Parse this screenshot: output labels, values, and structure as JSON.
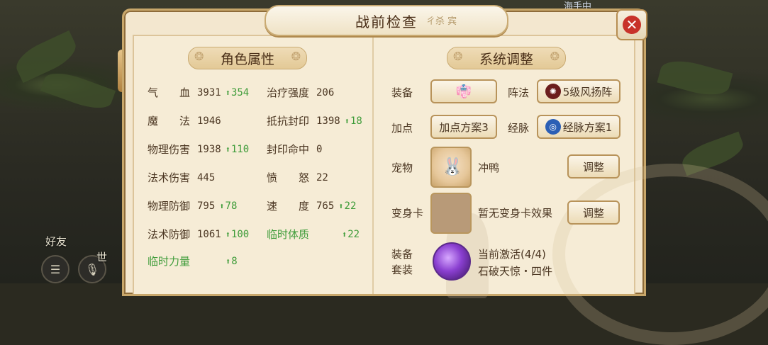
{
  "window": {
    "title": "战前检查",
    "title_deco": "ㄔ杀 宾",
    "top_tag": "海手中"
  },
  "hud": {
    "friends": "好友",
    "world": "世"
  },
  "attributes": {
    "header": "角色属性",
    "rows": [
      {
        "label": "气　　血",
        "value": "3931",
        "up": "354"
      },
      {
        "label": "治疗强度",
        "value": "206",
        "up": ""
      },
      {
        "label": "魔　　法",
        "value": "1946",
        "up": ""
      },
      {
        "label": "抵抗封印",
        "value": "1398",
        "up": "18"
      },
      {
        "label": "物理伤害",
        "value": "1938",
        "up": "110"
      },
      {
        "label": "封印命中",
        "value": "0",
        "up": ""
      },
      {
        "label": "法术伤害",
        "value": "445",
        "up": ""
      },
      {
        "label": "愤　　怒",
        "value": "22",
        "up": ""
      },
      {
        "label": "物理防御",
        "value": "795",
        "up": "78"
      },
      {
        "label": "速　　度",
        "value": "765",
        "up": "22"
      },
      {
        "label": "法术防御",
        "value": "1061",
        "up": "100"
      },
      {
        "label": "临时体质",
        "value": "",
        "up": "22"
      },
      {
        "label": "临时力量",
        "value": "",
        "up": "8"
      }
    ]
  },
  "system": {
    "header": "系统调整",
    "equip_label": "装备",
    "formation_label": "阵法",
    "formation_value": "5级风扬阵",
    "addpoint_label": "加点",
    "addpoint_value": "加点方案3",
    "meridian_label": "经脉",
    "meridian_value": "经脉方案1",
    "pet_label": "宠物",
    "pet_name": "冲鸭",
    "adjust": "调整",
    "transform_label": "变身卡",
    "transform_value": "暂无变身卡效果",
    "suit_label1": "装备",
    "suit_label2": "套装",
    "suit_status": "当前激活(4/4)",
    "suit_name": "石破天惊・四件"
  },
  "colors": {
    "green": "#3f9c3a",
    "panel": "#f3e7cf",
    "close": "#c8322a"
  }
}
